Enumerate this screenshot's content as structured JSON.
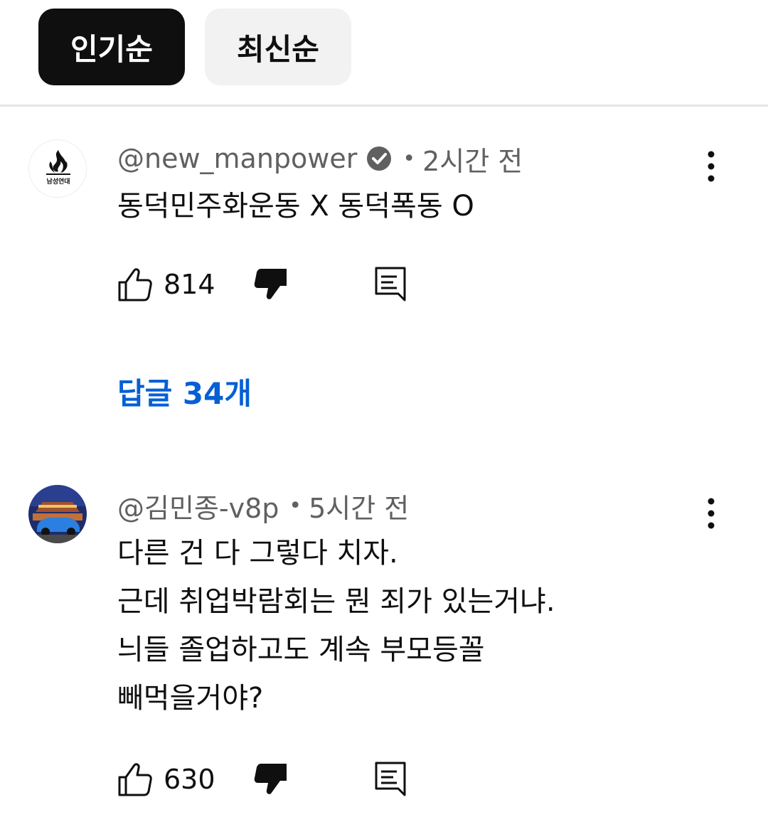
{
  "sort_chips": [
    {
      "label": "인기순",
      "active": true
    },
    {
      "label": "최신순",
      "active": false
    }
  ],
  "comments": [
    {
      "author": "@new_manpower",
      "verified": true,
      "separator": "•",
      "time": "2시간 전",
      "avatar_text": "남성연대",
      "lines": [
        "동덕민주화운동 X 동덕폭동 O"
      ],
      "likes": "814",
      "replies_label": "답글 34개"
    },
    {
      "author": "@김민종-v8p",
      "verified": false,
      "separator": "•",
      "time": "5시간 전",
      "lines": [
        "다른 건 다 그렇다 치자.",
        "근데 취업박람회는 뭔 죄가 있는거냐.",
        "늬들 졸업하고도 계속 부모등꼴",
        "빼먹을거야?"
      ],
      "likes": "630"
    }
  ],
  "colors": {
    "chip_active_bg": "#0f0f0f",
    "chip_inactive_bg": "#f2f2f2",
    "meta_text": "#606060",
    "link_blue": "#065fd4"
  },
  "icons": [
    "thumbs-up-icon",
    "thumbs-down-icon",
    "reply-icon",
    "more-vert-icon",
    "verified-icon"
  ]
}
